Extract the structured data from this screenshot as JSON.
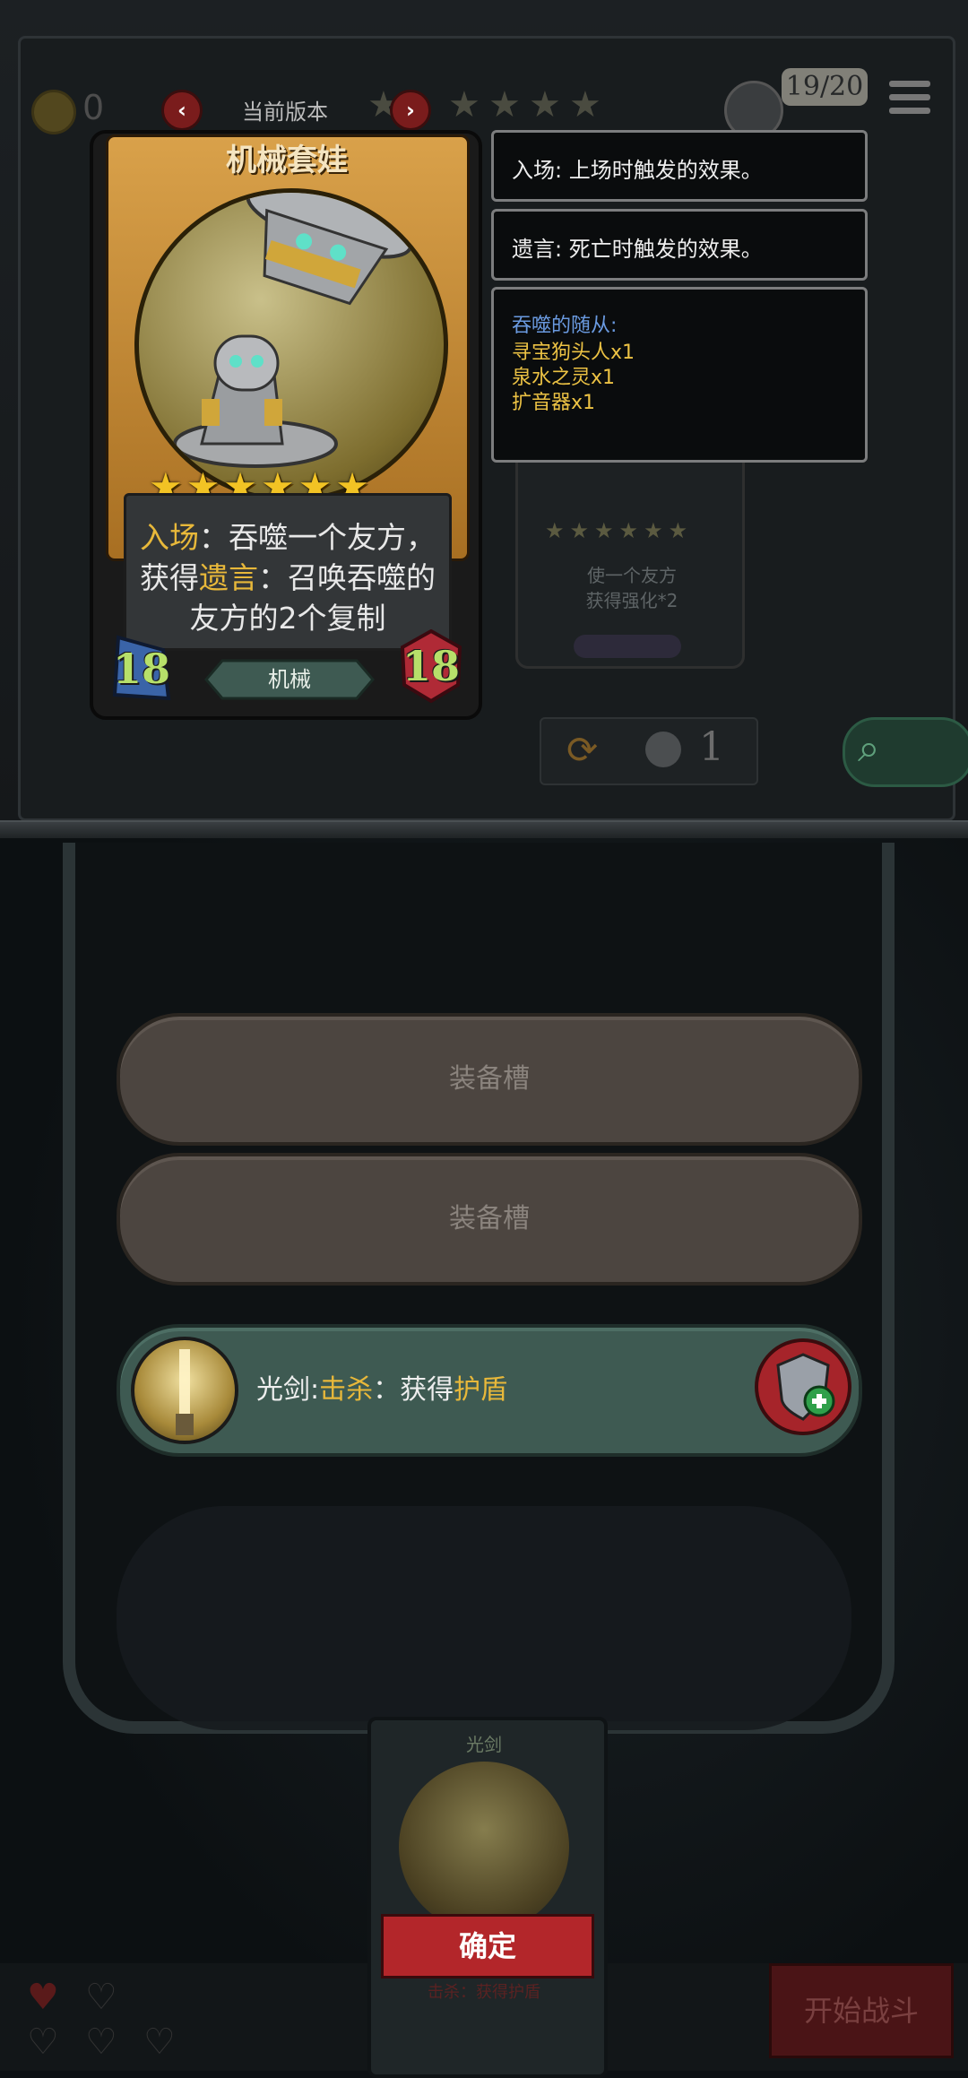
{
  "top_bar": {
    "coins": "0",
    "version_label": "当前版本",
    "prev_icon": "chevron-left-icon",
    "next_icon": "chevron-right-icon",
    "progress": "19/20",
    "menu_icon": "menu-icon"
  },
  "card": {
    "name": "机械套娃",
    "stars": "★★★★★★",
    "star_count": 6,
    "text_part1": "入场",
    "text_part2": "：吞噬一个友方，获得",
    "text_part3": "遗言",
    "text_part4": "：召唤吞噬的友方的2个复制",
    "attack": "18",
    "health": "18",
    "tribe": "机械"
  },
  "info_panel": {
    "battlecry": "入场: 上场时触发的效果。",
    "deathrattle": "遗言: 死亡时触发的效果。",
    "devoured_title": "吞噬的随从:",
    "devoured": [
      "寻宝狗头人x1",
      "泉水之灵x1",
      "扩音器x1"
    ]
  },
  "background_card": {
    "text_line1": "使一个友方",
    "text_line2": "获得强化*2"
  },
  "shop_controls": {
    "refresh_cost": "1",
    "refresh_icon": "refresh-icon",
    "search_icon": "search-icon"
  },
  "equip_slots": {
    "slot1_label": "装备槽",
    "slot2_label": "装备槽",
    "equipped_name": "光剑:",
    "equipped_keyword": "击杀",
    "equipped_sep": "：获得",
    "equipped_effect": "护盾",
    "shield_icon": "shield-plus-icon"
  },
  "bottom": {
    "card_title": "光剑",
    "card_sub": "击杀：获得护盾",
    "confirm_label": "确定",
    "start_battle_label": "开始战斗"
  },
  "colors": {
    "accent_gold": "#e8b83a",
    "accent_blue": "#6a9ae0",
    "confirm_red": "#b3262a",
    "equip_green": "#3e5a52"
  }
}
